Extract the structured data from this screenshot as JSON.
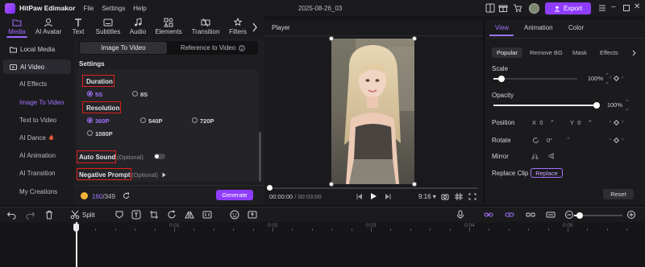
{
  "app": {
    "name": "HitPaw Edimakor",
    "menu": [
      "File",
      "Settings",
      "Help"
    ],
    "document_title": "2025-08-26_03",
    "export_label": "Export"
  },
  "toolbar": {
    "tabs": [
      {
        "label": "Media",
        "icon": "folder-icon",
        "active": true
      },
      {
        "label": "AI Avatar",
        "icon": "avatar-icon"
      },
      {
        "label": "Text",
        "icon": "text-icon"
      },
      {
        "label": "Subtitles",
        "icon": "subtitles-icon"
      },
      {
        "label": "Audio",
        "icon": "music-note-icon"
      },
      {
        "label": "Elements",
        "icon": "elements-icon"
      },
      {
        "label": "Transition",
        "icon": "transition-icon"
      },
      {
        "label": "Filters",
        "icon": "filters-icon"
      }
    ]
  },
  "sidebar": {
    "items": [
      {
        "label": "Local Media",
        "type": "main"
      },
      {
        "label": "AI Video",
        "type": "main",
        "active": true
      },
      {
        "label": "AI Effects",
        "type": "sub"
      },
      {
        "label": "Image To Video",
        "type": "sub",
        "active": true
      },
      {
        "label": "Text to Video",
        "type": "sub"
      },
      {
        "label": "AI Dance",
        "type": "sub"
      },
      {
        "label": "AI Animation",
        "type": "sub"
      },
      {
        "label": "AI Transition",
        "type": "sub"
      },
      {
        "label": "My Creations",
        "type": "sub"
      }
    ]
  },
  "settings": {
    "mode_tabs": [
      {
        "label": "Image To Video",
        "active": true
      },
      {
        "label": "Reference to Video"
      }
    ],
    "section_title": "Settings",
    "duration": {
      "label": "Duration",
      "options": [
        "5S",
        "8S"
      ],
      "selected": "5S"
    },
    "resolution": {
      "label": "Resolution",
      "options": [
        "360P",
        "540P",
        "720P",
        "1080P"
      ],
      "selected": "360P"
    },
    "auto_sound": {
      "label": "Auto Sound",
      "optional": "(Optional)",
      "enabled": false
    },
    "negative_prompt": {
      "label": "Negative Prompt",
      "optional": "(Optional)"
    },
    "credits": {
      "used": "160",
      "total": "/349"
    },
    "generate_label": "Generate"
  },
  "player": {
    "title": "Player",
    "current_time": "00:00:00",
    "total_time": " / 00:03:00",
    "aspect": "9:16"
  },
  "properties": {
    "tabs": [
      {
        "label": "View",
        "active": true
      },
      {
        "label": "Animation"
      },
      {
        "label": "Color"
      }
    ],
    "subtabs": [
      {
        "label": "Popular",
        "active": true
      },
      {
        "label": "Remove BG"
      },
      {
        "label": "Mask"
      },
      {
        "label": "Effects"
      }
    ],
    "scale": {
      "label": "Scale",
      "value": "100%",
      "fraction": 0.1
    },
    "opacity": {
      "label": "Opacity",
      "value": "100%",
      "fraction": 1.0
    },
    "position": {
      "label": "Position",
      "x_label": "X",
      "x": "0",
      "y_label": "Y",
      "y": "0"
    },
    "rotate": {
      "label": "Rotate",
      "value": "0°"
    },
    "mirror": {
      "label": "Mirror"
    },
    "replace_clip": {
      "label": "Replace Clip",
      "button": "Replace"
    },
    "reset_label": "Reset"
  },
  "timeline": {
    "split_label": "Split",
    "ruler_labels": [
      "00:00",
      "0:01",
      "0:02",
      "0:03",
      "0:04",
      "0:05"
    ],
    "zoom_fraction": 0.12
  },
  "colors": {
    "accent": "#8f3dfc",
    "accent_text": "#a372ff",
    "highlight_box": "#e01f1f"
  }
}
